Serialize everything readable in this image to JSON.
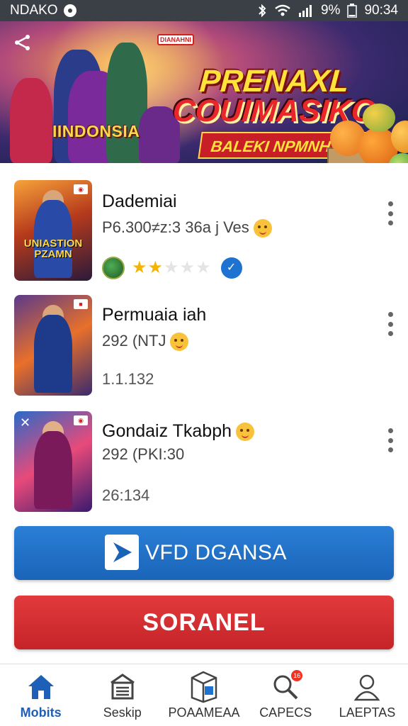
{
  "status_bar": {
    "carrier": "NDAKO",
    "battery": "9%",
    "time": "90:34"
  },
  "banner": {
    "country_text": "IINDONSIA",
    "badge_text": "DIANAHNI",
    "title_line1": "PRENAXL",
    "title_line2": "COUIMASIKO",
    "subtitle": "BALEKI NPMNHAA"
  },
  "items": [
    {
      "title": "Dademiai",
      "meta": "P6.300≠z:3 36a j Ves",
      "thumb_caption": "UNIASTION PZAMN",
      "rating_stars": 2,
      "rating_max": 5
    },
    {
      "title": "Permuaia iah",
      "meta": "292 (NTJ",
      "extra": "1.1.132"
    },
    {
      "title": "Gondaiz Tkabph",
      "meta": "292 (PKI:30",
      "extra": "26:134"
    }
  ],
  "buttons": {
    "primary_label": "VFD DGANSA",
    "secondary_label": "SORANEL"
  },
  "nav": {
    "items": [
      {
        "label": "Mobits",
        "icon": "home-icon",
        "active": true
      },
      {
        "label": "Seskip",
        "icon": "list-icon",
        "active": false
      },
      {
        "label": "POAAMEAA",
        "icon": "box-icon",
        "active": false
      },
      {
        "label": "CAPECS",
        "icon": "search-icon",
        "active": false,
        "badge": "16"
      },
      {
        "label": "LAEPTAS",
        "icon": "profile-icon",
        "active": false
      }
    ]
  },
  "colors": {
    "primary_button": "#1a64b8",
    "secondary_button": "#c52428",
    "nav_active": "#1e5fb8",
    "star": "#f4b400"
  }
}
